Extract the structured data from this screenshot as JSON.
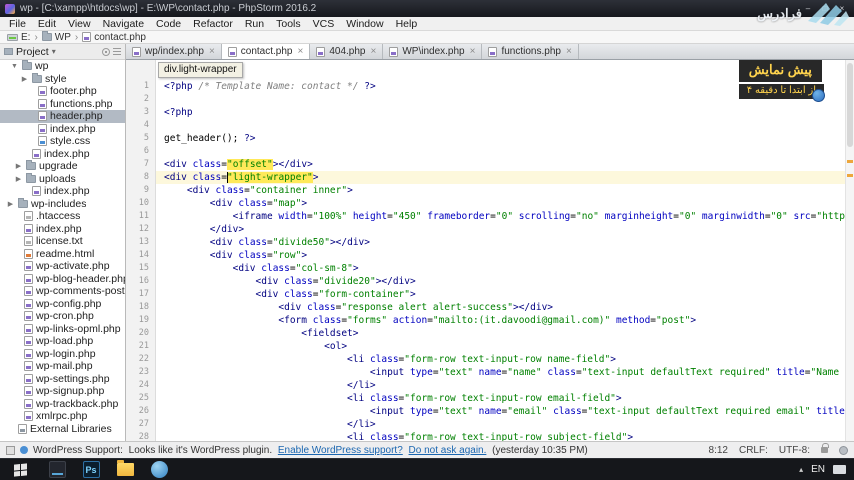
{
  "window": {
    "title": "wp - [C:\\xampp\\htdocs\\wp] - E:\\WP\\contact.php - PhpStorm 2016.2",
    "controls": {
      "minimize": "–",
      "maximize": "□",
      "close": "×"
    }
  },
  "menu_bar": {
    "items": [
      "File",
      "Edit",
      "View",
      "Navigate",
      "Code",
      "Refactor",
      "Run",
      "Tools",
      "VCS",
      "Window",
      "Help"
    ]
  },
  "nav_bar": {
    "items": [
      {
        "label": "E:",
        "icon": "drive"
      },
      {
        "label": "WP",
        "icon": "folder"
      },
      {
        "label": "contact.php",
        "icon": "php"
      }
    ]
  },
  "tabs": [
    {
      "label": "wp/index.php",
      "active": false
    },
    {
      "label": "contact.php",
      "active": true
    },
    {
      "label": "404.php",
      "active": false
    },
    {
      "label": "WP\\index.php",
      "active": false
    },
    {
      "label": "functions.php",
      "active": false
    }
  ],
  "project_panel": {
    "header": "Project",
    "items": [
      {
        "label": "wp",
        "icon": "folder",
        "arrow": "v",
        "pad": 10
      },
      {
        "label": "style",
        "icon": "folder",
        "arrow": ">",
        "pad": 20
      },
      {
        "label": "footer.php",
        "icon": "php",
        "pad": 26
      },
      {
        "label": "functions.php",
        "icon": "php",
        "pad": 26
      },
      {
        "label": "header.php",
        "icon": "php",
        "pad": 26,
        "selected": true
      },
      {
        "label": "index.php",
        "icon": "php",
        "pad": 26
      },
      {
        "label": "style.css",
        "icon": "css",
        "pad": 26
      },
      {
        "label": "index.php",
        "icon": "php",
        "pad": 20
      },
      {
        "label": "upgrade",
        "icon": "folder",
        "arrow": ">",
        "pad": 14
      },
      {
        "label": "uploads",
        "icon": "folder",
        "arrow": ">",
        "pad": 14
      },
      {
        "label": "index.php",
        "icon": "php",
        "pad": 20
      },
      {
        "label": "wp-includes",
        "icon": "folder",
        "arrow": ">",
        "pad": 6
      },
      {
        "label": ".htaccess",
        "icon": "txt",
        "pad": 12
      },
      {
        "label": "index.php",
        "icon": "php",
        "pad": 12
      },
      {
        "label": "license.txt",
        "icon": "txt",
        "pad": 12
      },
      {
        "label": "readme.html",
        "icon": "html",
        "pad": 12
      },
      {
        "label": "wp-activate.php",
        "icon": "php",
        "pad": 12
      },
      {
        "label": "wp-blog-header.php",
        "icon": "php",
        "pad": 12
      },
      {
        "label": "wp-comments-post.php",
        "icon": "php",
        "pad": 12
      },
      {
        "label": "wp-config.php",
        "icon": "php",
        "pad": 12
      },
      {
        "label": "wp-cron.php",
        "icon": "php",
        "pad": 12
      },
      {
        "label": "wp-links-opml.php",
        "icon": "php",
        "pad": 12
      },
      {
        "label": "wp-load.php",
        "icon": "php",
        "pad": 12
      },
      {
        "label": "wp-login.php",
        "icon": "php",
        "pad": 12
      },
      {
        "label": "wp-mail.php",
        "icon": "php",
        "pad": 12
      },
      {
        "label": "wp-settings.php",
        "icon": "php",
        "pad": 12
      },
      {
        "label": "wp-signup.php",
        "icon": "php",
        "pad": 12
      },
      {
        "label": "wp-trackback.php",
        "icon": "php",
        "pad": 12
      },
      {
        "label": "xmlrpc.php",
        "icon": "php",
        "pad": 12
      },
      {
        "label": "External Libraries",
        "icon": "lib",
        "pad": 6
      }
    ]
  },
  "editor": {
    "tooltip": "div.light-wrapper",
    "caret_line": 8,
    "highlights": [
      {
        "line": 7,
        "text": "\"offset\""
      },
      {
        "line": 8,
        "text": "\"light-wrapper\"",
        "caret": true
      }
    ],
    "lines": [
      "<?php /* Template Name: contact */ ?>",
      "",
      "<?php",
      "",
      "get_header(); ?>",
      "",
      "<div class=\"offset\"></div>",
      "<div class=\"light-wrapper\">",
      "    <div class=\"container inner\">",
      "        <div class=\"map\">",
      "            <iframe width=\"100%\" height=\"450\" frameborder=\"0\" scrolling=\"no\" marginheight=\"0\" marginwidth=\"0\" src=\"https://",
      "        </div>",
      "        <div class=\"divide50\"></div>",
      "        <div class=\"row\">",
      "            <div class=\"col-sm-8\">",
      "                <div class=\"divide20\"></div>",
      "                <div class=\"form-container\">",
      "                    <div class=\"response alert alert-success\"></div>",
      "                    <form class=\"forms\" action=\"mailto:(it.davoodi@gmail.com)\" method=\"post\">",
      "                        <fieldset>",
      "                            <ol>",
      "                                <li class=\"form-row text-input-row name-field\">",
      "                                    <input type=\"text\" name=\"name\" class=\"text-input defaultText required\" title=\"Name (Re",
      "                                </li>",
      "                                <li class=\"form-row text-input-row email-field\">",
      "                                    <input type=\"text\" name=\"email\" class=\"text-input defaultText required email\" title=\"",
      "                                </li>",
      "                                <li class=\"form-row text-input-row subject-field\">"
    ]
  },
  "status_bar": {
    "message_label": "WordPress Support:",
    "message_text": "Looks like it's WordPress plugin.",
    "link_enable": "Enable WordPress support?",
    "link_dismiss": "Do not ask again.",
    "message_time": "(yesterday 10:35 PM)",
    "caret_position": "8:12",
    "line_separator": "CRLF:",
    "encoding": "UTF-8:"
  },
  "overlay": {
    "line1": "پیش نمایش",
    "line2": "از ابتدا تا دقیقه ۴"
  },
  "watermark": {
    "brand": "فرادرس"
  },
  "taskbar": {
    "icons": [
      {
        "name": "terminal"
      },
      {
        "name": "photoshop",
        "label": "Ps"
      },
      {
        "name": "explorer"
      },
      {
        "name": "browser"
      }
    ],
    "tray_language": "EN"
  },
  "colors": {
    "accent_highlight": "#ffe959",
    "caret_line": "#fdf8dc",
    "selection_unfocused": "#b2bac4",
    "overlay_text": "#ffd34d",
    "string_green": "#008000",
    "tag_navy": "#000080"
  }
}
